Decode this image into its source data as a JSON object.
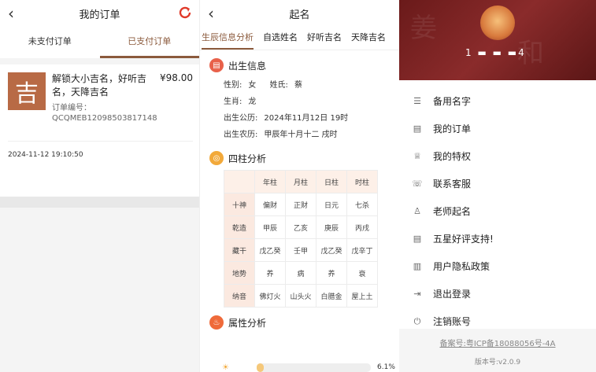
{
  "p1": {
    "title": "我的订单",
    "tabs": [
      "未支付订单",
      "已支付订单"
    ],
    "order": {
      "icon_char": "吉",
      "name": "解锁大小吉名，好听吉名，天降吉名",
      "price": "¥98.00",
      "no_label": "订单编号：",
      "no": "QCQMEB12098503817148",
      "date": "2024-11-12 19:10:50"
    }
  },
  "p2": {
    "title": "起名",
    "tabs": [
      "生辰信息分析",
      "自选姓名",
      "好听吉名",
      "天降吉名"
    ],
    "birth": {
      "section": "出生信息",
      "gender_label": "性别:",
      "gender": "女",
      "surname_label": "姓氏:",
      "surname": "蔡",
      "zodiac_label": "生肖:",
      "zodiac": "龙",
      "solar_label": "出生公历:",
      "solar": "2024年11月12日 19时",
      "lunar_label": "出生农历:",
      "lunar": "甲辰年十月十二 戌时"
    },
    "pillars": {
      "section": "四柱分析",
      "header": [
        "",
        "年柱",
        "月柱",
        "日柱",
        "时柱"
      ],
      "rows": [
        [
          "十神",
          "偏财",
          "正财",
          "日元",
          "七杀"
        ],
        [
          "乾造",
          "甲辰",
          "乙亥",
          "庚辰",
          "丙戌"
        ],
        [
          "藏干",
          "戊乙癸",
          "壬甲",
          "戊乙癸",
          "戊辛丁"
        ],
        [
          "地势",
          "养",
          "病",
          "养",
          "衰"
        ],
        [
          "纳音",
          "佛灯火",
          "山头火",
          "白腊金",
          "屋上土"
        ]
      ]
    },
    "attr": {
      "section": "属性分析",
      "pct": "6.1%",
      "value": 0.061
    }
  },
  "p3": {
    "username": "1 ▬ ▬ ▬4",
    "menu": [
      "备用名字",
      "我的订单",
      "我的特权",
      "联系客服",
      "老师起名",
      "五星好评支持!",
      "用户隐私政策",
      "退出登录",
      "注销账号"
    ],
    "icp": "备案号:粤ICP备18088056号-4A",
    "version": "版本号:v2.0.9"
  },
  "colors": {
    "accent": "#8b5a3c",
    "refresh": "#e03a2a",
    "banner": "#7a2222"
  }
}
